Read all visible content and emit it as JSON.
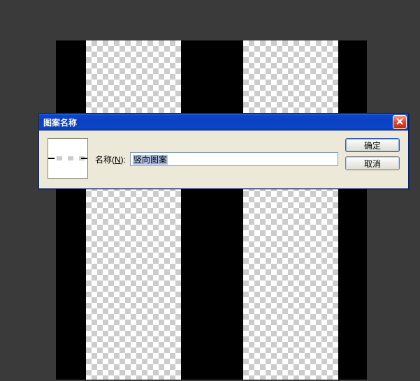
{
  "dialog": {
    "title": "图案名称",
    "name_label_prefix": "名称(",
    "name_label_mnemonic": "N",
    "name_label_suffix": "):",
    "name_value": "竖向图案",
    "ok_label": "确定",
    "cancel_label": "取消"
  }
}
